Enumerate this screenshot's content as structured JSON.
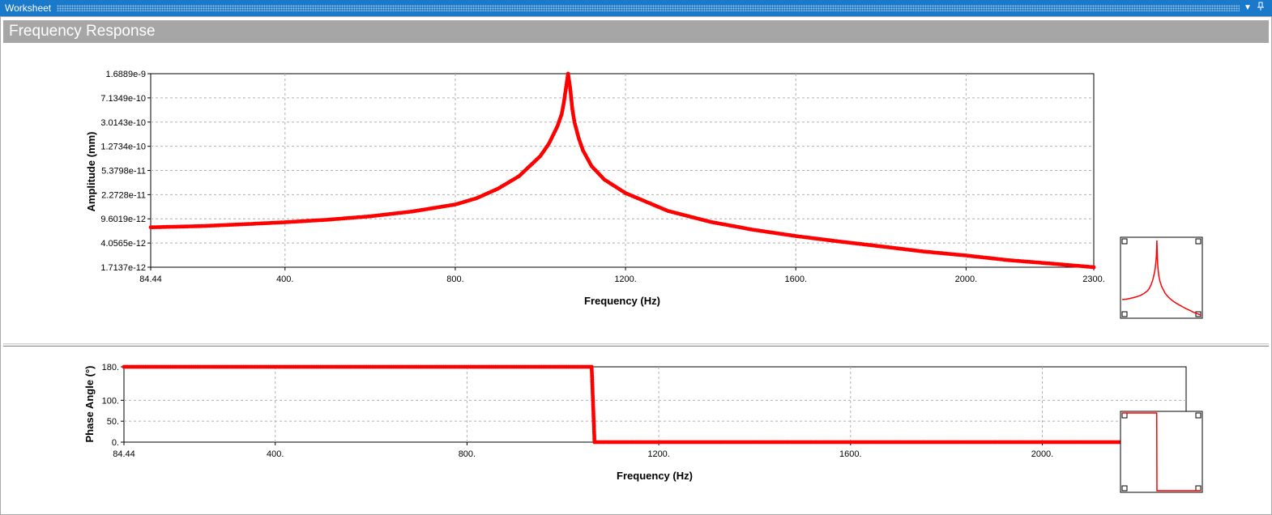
{
  "window": {
    "title": "Worksheet",
    "dropdown_icon": "chevron-down-icon",
    "pin_icon": "pin-icon"
  },
  "header": {
    "title": "Frequency Response"
  },
  "colors": {
    "series": "#ff0000",
    "titlebar": "#1b79c9",
    "header": "#a6a6a6",
    "grid": "#b0b0b0"
  },
  "chart_data": [
    {
      "type": "line",
      "name": "amplitude",
      "title": "",
      "xlabel": "Frequency (Hz)",
      "ylabel": "Amplitude (mm)",
      "xlim": [
        84.44,
        2300
      ],
      "ylim": [
        1.7137e-12,
        1.6889e-09
      ],
      "yscale": "log",
      "grid": true,
      "x_ticks": [
        "84.44",
        "400.",
        "800.",
        "1200.",
        "1600.",
        "2000.",
        "2300."
      ],
      "y_ticks": [
        "1.6889e-9",
        "7.1349e-10",
        "3.0143e-10",
        "1.2734e-10",
        "5.3798e-11",
        "2.2728e-11",
        "9.6019e-12",
        "4.0565e-12",
        "1.7137e-12"
      ],
      "series": [
        {
          "marker": "circle",
          "x": [
            84.44,
            200,
            300,
            400,
            500,
            600,
            700,
            800,
            850,
            900,
            950,
            1000,
            1020,
            1040,
            1050,
            1055,
            1060,
            1065,
            1070,
            1075,
            1080,
            1090,
            1100,
            1120,
            1150,
            1200,
            1300,
            1400,
            1500,
            1600,
            1700,
            1800,
            1900,
            2000,
            2100,
            2200,
            2300
          ],
          "y": [
            7.1e-12,
            7.4e-12,
            7.9e-12,
            8.5e-12,
            9.3e-12,
            1.05e-11,
            1.25e-11,
            1.6e-11,
            2e-11,
            2.8e-11,
            4.4e-11,
            9e-11,
            1.4e-10,
            2.6e-10,
            4e-10,
            6e-10,
            1e-09,
            1.6889e-09,
            1e-09,
            4.8e-10,
            3e-10,
            1.7e-10,
            1.1e-10,
            6.3e-11,
            3.9e-11,
            2.4e-11,
            1.27e-11,
            8.6e-12,
            6.5e-12,
            5.2e-12,
            4.3e-12,
            3.6e-12,
            3e-12,
            2.6e-12,
            2.2e-12,
            1.95e-12,
            1.7137e-12
          ]
        }
      ]
    },
    {
      "type": "line",
      "name": "phase",
      "title": "",
      "xlabel": "Frequency (Hz)",
      "ylabel": "Phase Angle (°)",
      "xlim": [
        84.44,
        2300
      ],
      "ylim": [
        0,
        180
      ],
      "grid": true,
      "x_ticks": [
        "84.44",
        "400.",
        "800.",
        "1200.",
        "1600.",
        "2000."
      ],
      "y_ticks": [
        "180.",
        "100.",
        "50.",
        "0."
      ],
      "series": [
        {
          "marker": "circle",
          "x": [
            84.44,
            1060,
            1066,
            2300
          ],
          "y": [
            180,
            180,
            0,
            0
          ]
        }
      ]
    }
  ]
}
